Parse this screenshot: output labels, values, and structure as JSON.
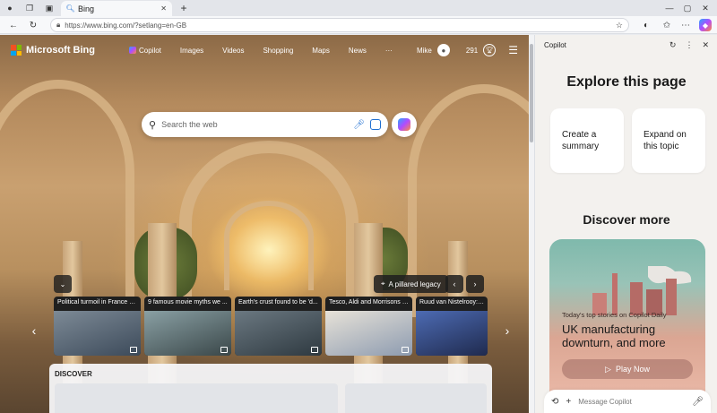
{
  "browser": {
    "tab_title": "Bing",
    "url": "https://www.bing.com/?setlang=en-GB"
  },
  "bing": {
    "logo_text": "Microsoft Bing",
    "nav": [
      "Copilot",
      "Images",
      "Videos",
      "Shopping",
      "Maps",
      "News",
      "···"
    ],
    "user_name": "Mike",
    "rewards_points": "291",
    "search_placeholder": "Search the web",
    "image_pill": "A pillared legacy",
    "news": [
      {
        "title": "Political turmoil in France s...",
        "thumb": "#3c4a5a"
      },
      {
        "title": "9 famous movie myths we ...",
        "thumb": "#5a6a6c"
      },
      {
        "title": "Earth's crust found to be 'd...",
        "thumb": "#4b5963"
      },
      {
        "title": "Tesco, Aldi and Morrisons f...",
        "thumb": "#c9c2b6"
      },
      {
        "title": "Ruud van Nistelrooy: r...",
        "thumb": "#2f3e6e"
      }
    ],
    "discover_label": "DISCOVER"
  },
  "copilot": {
    "panel_title": "Copilot",
    "explore_title": "Explore this page",
    "suggestions": [
      "Create a summary",
      "Expand on this topic"
    ],
    "discover_title": "Discover more",
    "story_kicker": "Today's top stories on Copilot Daily",
    "story_headline": "UK manufacturing downturn, and more",
    "play_label": "Play Now",
    "composer_placeholder": "Message Copilot"
  }
}
